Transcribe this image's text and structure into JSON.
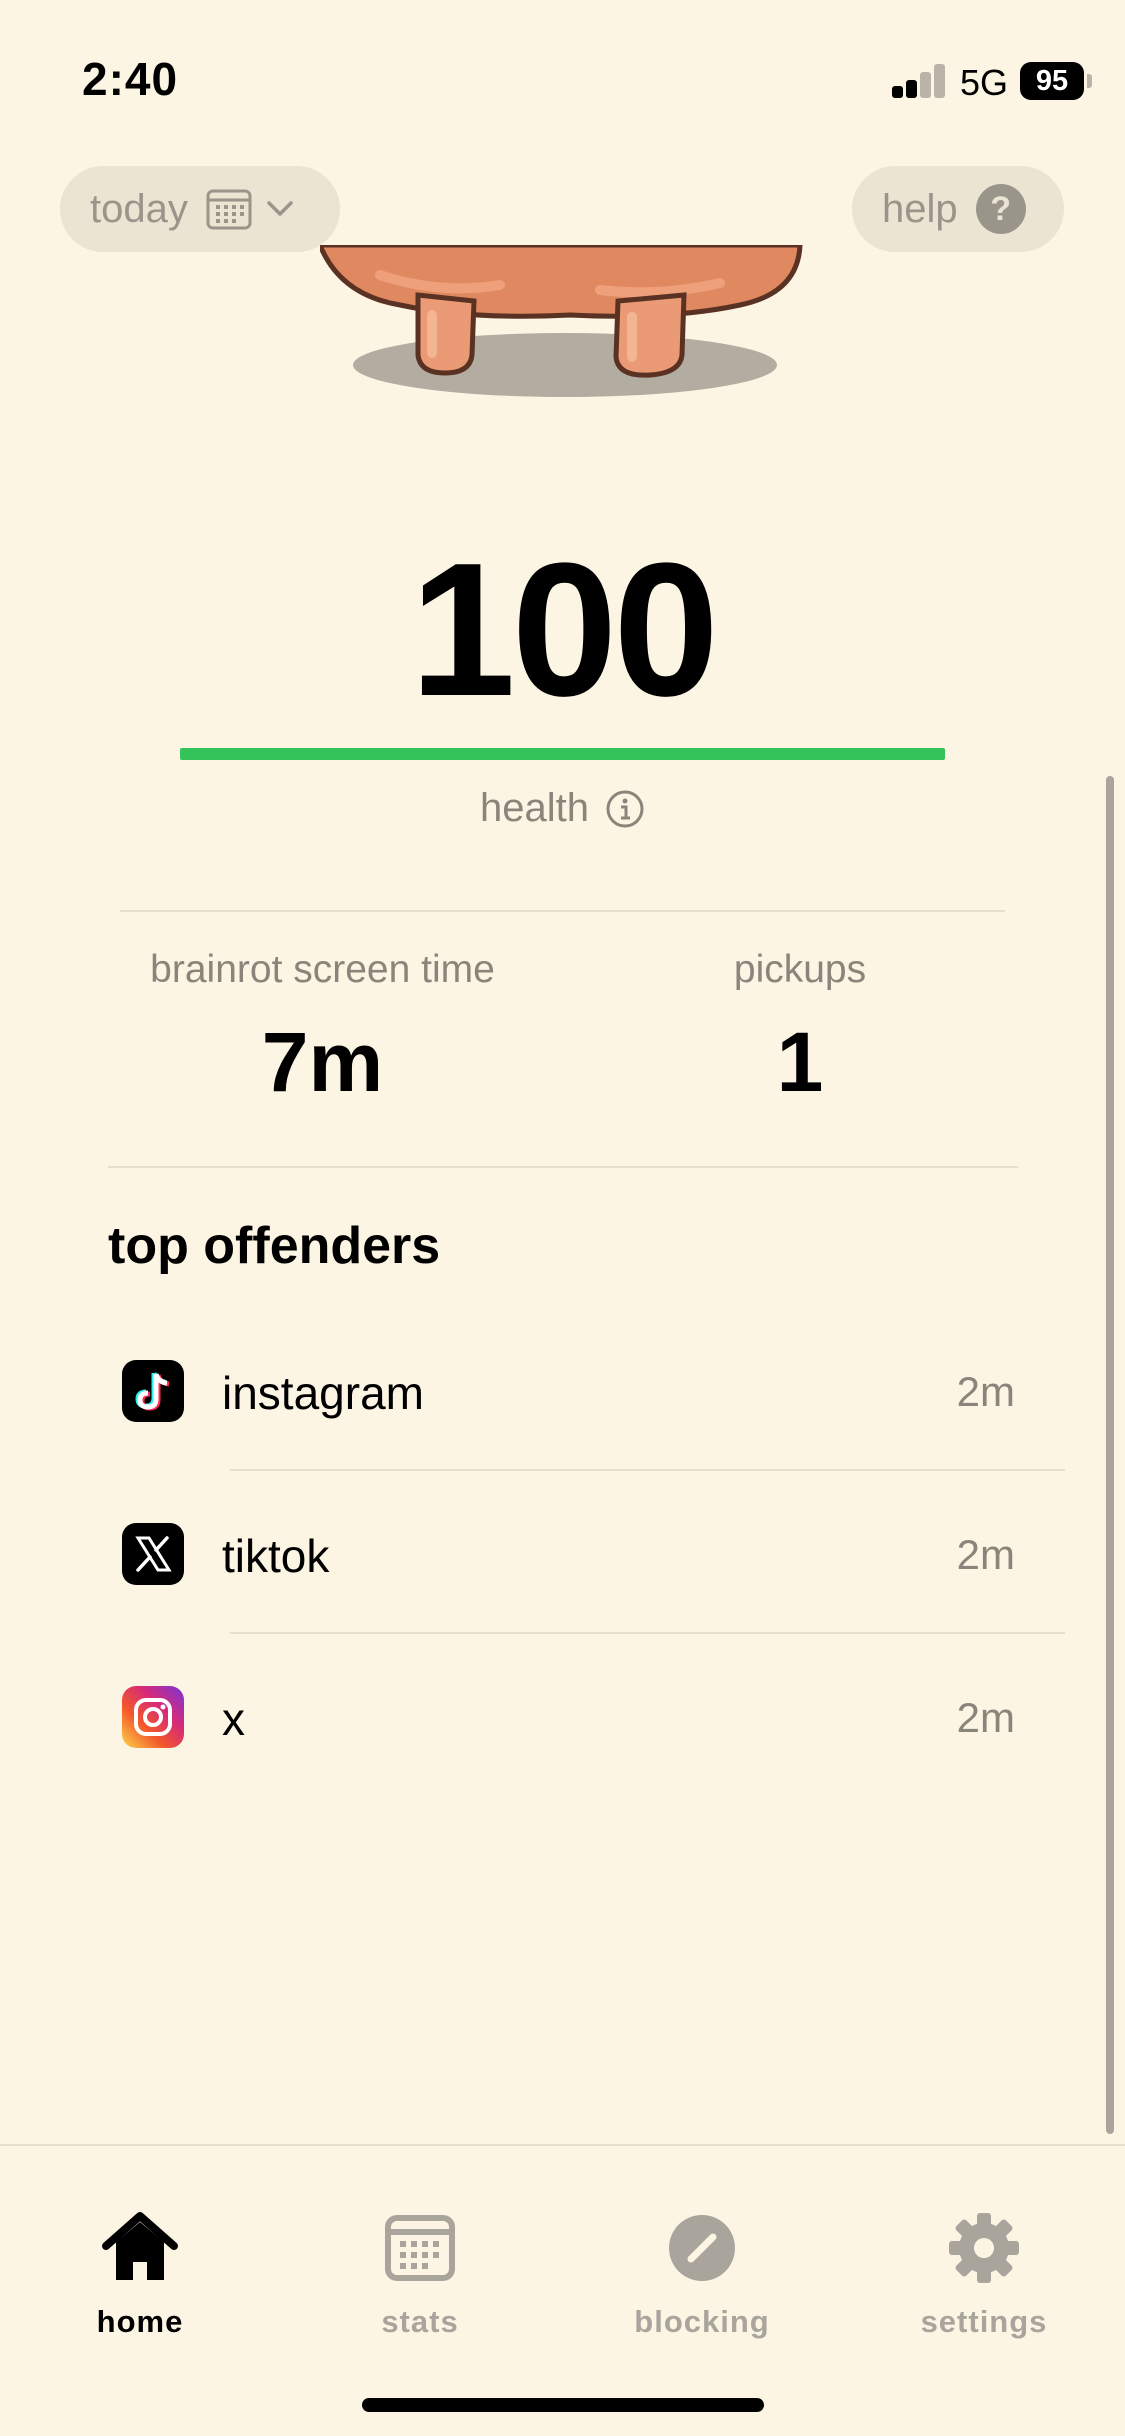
{
  "status_bar": {
    "time": "2:40",
    "network": "5G",
    "battery": "95"
  },
  "top_bar": {
    "date_filter_label": "today",
    "help_label": "help",
    "help_icon_glyph": "?"
  },
  "health": {
    "score": "100",
    "level_percent": 100,
    "label": "health",
    "bar_color": "#34c25a"
  },
  "stats": {
    "screen_time_label": "brainrot screen time",
    "screen_time_value": "7m",
    "pickups_label": "pickups",
    "pickups_value": "1"
  },
  "top_offenders": {
    "title": "top offenders",
    "items": [
      {
        "name": "instagram",
        "time": "2m",
        "icon": "tiktok-logo-icon"
      },
      {
        "name": "tiktok",
        "time": "2m",
        "icon": "x-logo-icon"
      },
      {
        "name": "x",
        "time": "2m",
        "icon": "instagram-logo-icon"
      }
    ]
  },
  "tab_bar": {
    "tabs": [
      {
        "label": "home",
        "icon": "house-icon",
        "active": true
      },
      {
        "label": "stats",
        "icon": "calendar-icon",
        "active": false
      },
      {
        "label": "blocking",
        "icon": "block-icon",
        "active": false
      },
      {
        "label": "settings",
        "icon": "gear-icon",
        "active": false
      }
    ]
  }
}
